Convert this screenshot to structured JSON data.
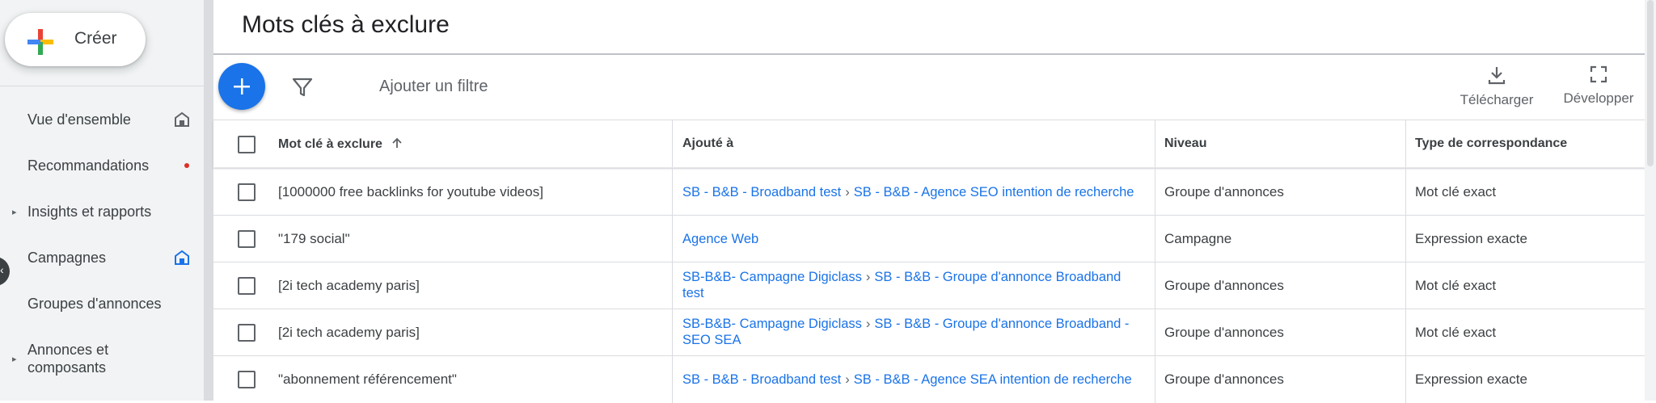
{
  "sidebar": {
    "create_label": "Créer",
    "items": [
      {
        "label": "Vue d'ensemble"
      },
      {
        "label": "Recommandations"
      },
      {
        "label": "Insights et rapports"
      },
      {
        "label": "Campagnes"
      },
      {
        "label": "Groupes d'annonces"
      },
      {
        "label": "Annonces et composants"
      }
    ]
  },
  "main": {
    "title": "Mots clés à exclure",
    "toolbar": {
      "filter_label": "Ajouter un filtre",
      "download_label": "Télécharger",
      "expand_label": "Développer"
    },
    "table": {
      "headers": {
        "keyword": "Mot clé à exclure",
        "added_to": "Ajouté à",
        "level": "Niveau",
        "match_type": "Type de correspondance"
      },
      "rows": [
        {
          "keyword": "[1000000 free backlinks for youtube videos]",
          "campaign": "SB - B&B - Broadband test",
          "sep": "›",
          "adgroup": "SB - B&B - Agence SEO intention de recherche",
          "level": "Groupe d'annonces",
          "match": "Mot clé exact"
        },
        {
          "keyword": "\"179 social\"",
          "campaign": "Agence Web",
          "sep": "",
          "adgroup": "",
          "level": "Campagne",
          "match": "Expression exacte"
        },
        {
          "keyword": "[2i tech academy paris]",
          "campaign": "SB-B&B- Campagne Digiclass",
          "sep": "›",
          "adgroup": "SB - B&B - Groupe d'annonce Broadband test",
          "level": "Groupe d'annonces",
          "match": "Mot clé exact"
        },
        {
          "keyword": "[2i tech academy paris]",
          "campaign": "SB-B&B- Campagne Digiclass",
          "sep": "›",
          "adgroup": "SB - B&B - Groupe d'annonce Broadband - SEO SEA",
          "level": "Groupe d'annonces",
          "match": "Mot clé exact"
        },
        {
          "keyword": "\"abonnement référencement\"",
          "campaign": "SB - B&B - Broadband test",
          "sep": "›",
          "adgroup": "SB - B&B - Agence SEA intention de recherche",
          "level": "Groupe d'annonces",
          "match": "Expression exacte"
        }
      ]
    }
  },
  "colors": {
    "accent": "#1a73e8",
    "notification_dot": "#d93025"
  }
}
